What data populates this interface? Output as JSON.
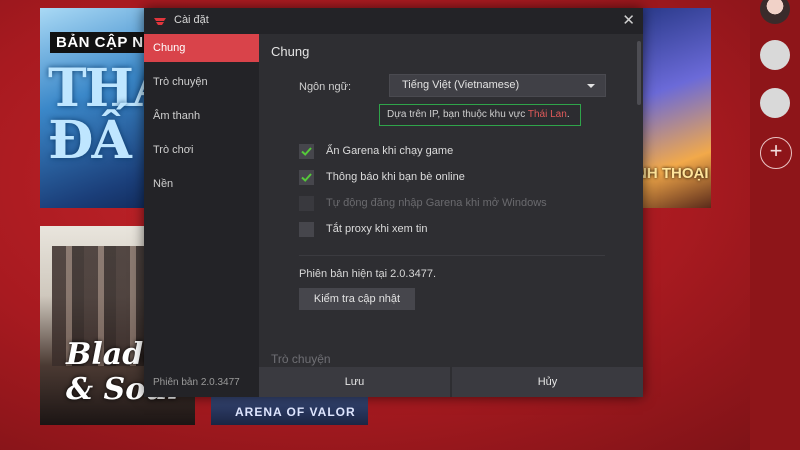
{
  "background": {
    "tile1_banner": "BẢN CẬP NH",
    "tile1_bigtext": "THA ĐẤ",
    "tile2_logo_text": "Blade & Soul",
    "tile3_text": "NH THOẠI",
    "tile4_text": "ARENA OF VALOR"
  },
  "dialog": {
    "title": "Cài đặt",
    "nav": {
      "items": [
        {
          "label": "Chung",
          "active": true
        },
        {
          "label": "Trò chuyện",
          "active": false
        },
        {
          "label": "Âm thanh",
          "active": false
        },
        {
          "label": "Trò chơi",
          "active": false
        },
        {
          "label": "Nền",
          "active": false
        }
      ],
      "version": "Phiên bản 2.0.3477"
    },
    "general": {
      "section_title": "Chung",
      "language_label": "Ngôn ngữ:",
      "language_value": "Tiếng Việt (Vietnamese)",
      "ip_note_prefix": "Dựa trên IP, bạn thuộc khu vực ",
      "ip_note_country": "Thái Lan",
      "ip_note_suffix": ".",
      "options": [
        {
          "label": "Ẩn Garena khi chạy game",
          "checked": true,
          "disabled": false
        },
        {
          "label": "Thông báo khi bạn bè online",
          "checked": true,
          "disabled": false
        },
        {
          "label": "Tự động đăng nhập Garena khi mở Windows",
          "checked": false,
          "disabled": true
        },
        {
          "label": "Tắt proxy khi xem tin",
          "checked": false,
          "disabled": false
        }
      ],
      "current_version": "Phiên bản hiện tại 2.0.3477.",
      "update_button": "Kiểm tra cập nhật",
      "next_section_title": "Trò chuyện"
    },
    "footer": {
      "save": "Lưu",
      "cancel": "Hủy"
    }
  },
  "colors": {
    "accent": "#d9434a",
    "ip_note_border": "#2fa44a",
    "country_text": "#e05a5a",
    "checkmark": "#55c93a"
  }
}
